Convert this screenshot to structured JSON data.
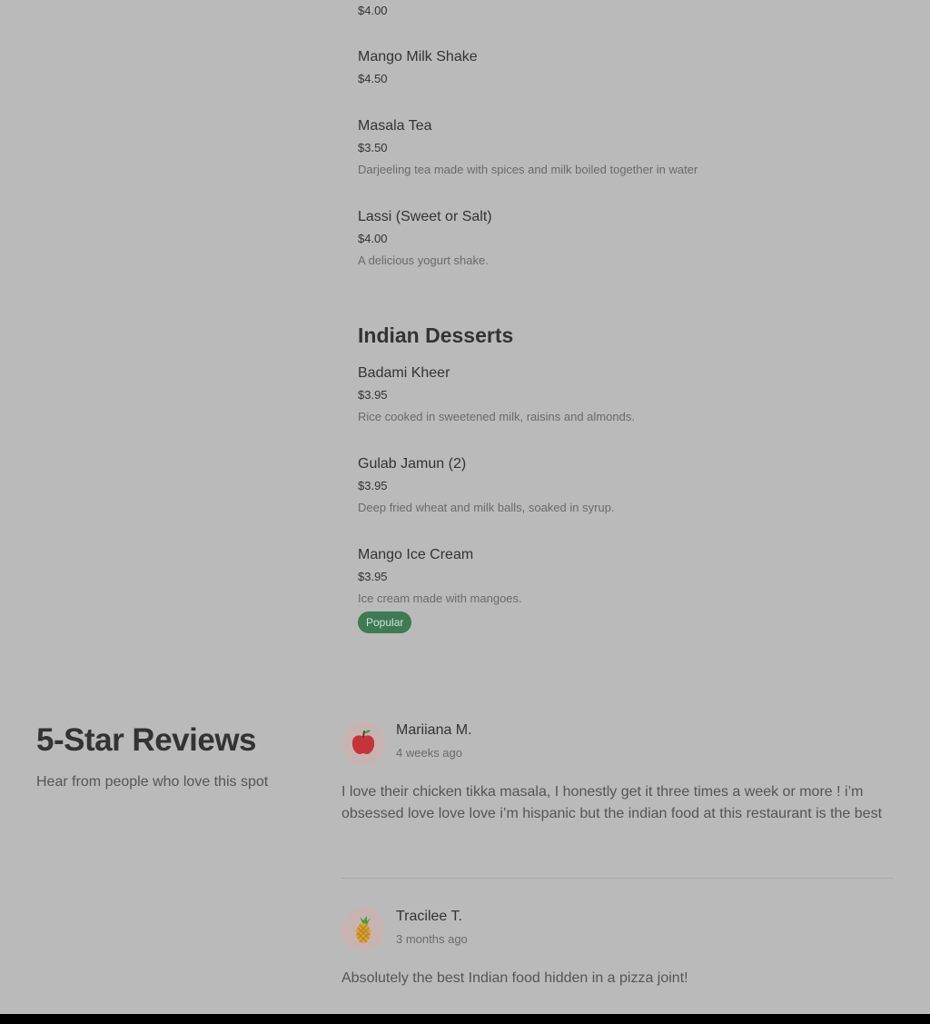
{
  "drinks": [
    {
      "price": "$4.00"
    },
    {
      "name": "Mango Milk Shake",
      "price": "$4.50"
    },
    {
      "name": "Masala Tea",
      "price": "$3.50",
      "description": "Darjeeling tea made with spices and milk boiled together in water"
    },
    {
      "name": "Lassi (Sweet or Salt)",
      "price": "$4.00",
      "description": "A delicious yogurt shake."
    }
  ],
  "desserts": {
    "title": "Indian Desserts",
    "items": [
      {
        "name": "Badami Kheer",
        "price": "$3.95",
        "description": "Rice cooked in sweetened milk, raisins and almonds."
      },
      {
        "name": "Gulab Jamun (2)",
        "price": "$3.95",
        "description": "Deep fried wheat and milk balls, soaked in syrup."
      },
      {
        "name": "Mango Ice Cream",
        "price": "$3.95",
        "description": "Ice cream made with mangoes.",
        "badge": "Popular"
      }
    ]
  },
  "reviews": {
    "title": "5-Star Reviews",
    "subtitle": "Hear from people who love this spot",
    "items": [
      {
        "name": "Mariiana M.",
        "time": "4 weeks ago",
        "text": "I love their chicken tikka masala, I honestly get it three times a week or more ! i’m obsessed love love love i’m hispanic but the indian food at this restaurant is the best",
        "avatar_icon": "apple-icon"
      },
      {
        "name": "Tracilee T.",
        "time": "3 months ago",
        "text": "Absolutely the best Indian food hidden in a pizza joint!",
        "avatar_icon": "pineapple-icon"
      }
    ]
  },
  "colors": {
    "background": "#bababa",
    "badge": "#3f7a55",
    "footer": "#000000"
  }
}
